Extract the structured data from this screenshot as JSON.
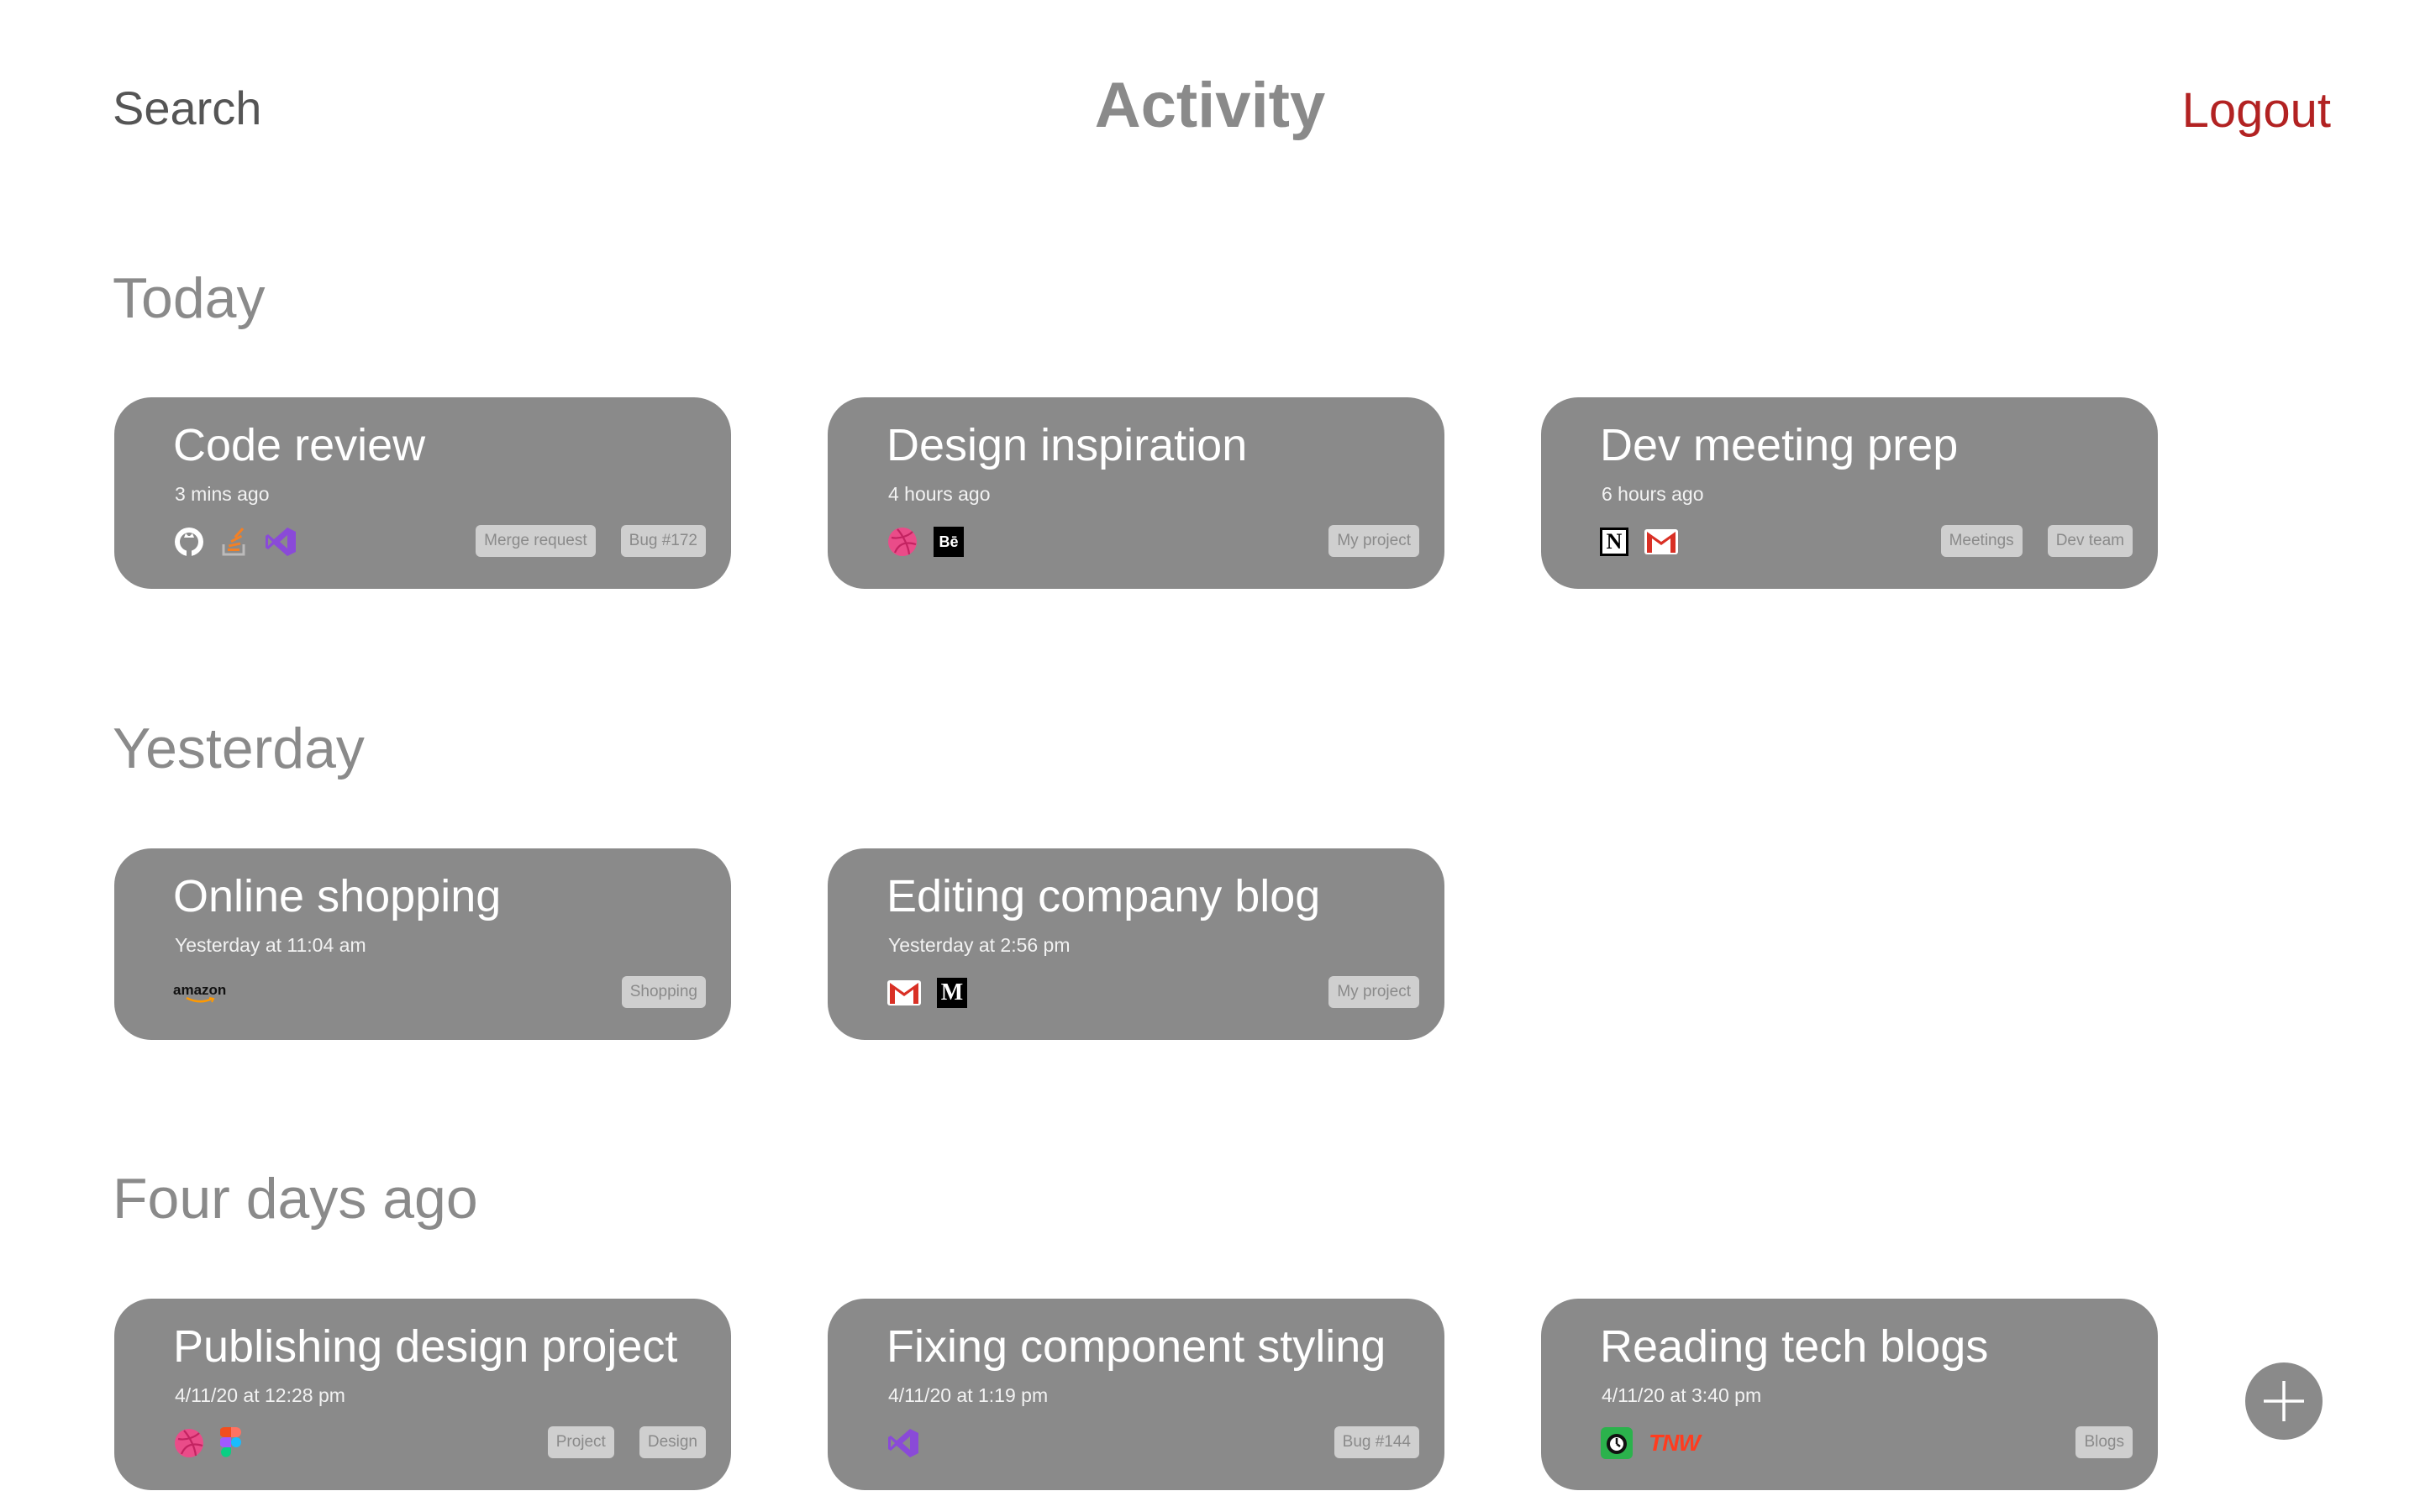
{
  "header": {
    "search_label": "Search",
    "title": "Activity",
    "logout_label": "Logout"
  },
  "sections": [
    {
      "title": "Today",
      "cards": [
        {
          "title": "Code review",
          "time": "3 mins ago",
          "icons": [
            "github-icon",
            "stack-overflow-icon",
            "visual-studio-icon"
          ],
          "tags": [
            "Merge request",
            "Bug #172"
          ]
        },
        {
          "title": "Design inspiration",
          "time": "4 hours ago",
          "icons": [
            "dribbble-icon",
            "behance-icon"
          ],
          "tags": [
            "My project"
          ]
        },
        {
          "title": "Dev meeting prep",
          "time": "6 hours ago",
          "icons": [
            "notion-icon",
            "gmail-icon"
          ],
          "tags": [
            "Meetings",
            "Dev team"
          ]
        }
      ]
    },
    {
      "title": "Yesterday",
      "cards": [
        {
          "title": "Online shopping",
          "time": "Yesterday at 11:04 am",
          "icons": [
            "amazon-icon"
          ],
          "icon_text": {
            "amazon": "amazon"
          },
          "tags": [
            "Shopping"
          ]
        },
        {
          "title": "Editing company blog",
          "time": "Yesterday at 2:56 pm",
          "icons": [
            "gmail-icon",
            "medium-icon"
          ],
          "tags": [
            "My project"
          ]
        }
      ]
    },
    {
      "title": "Four days ago",
      "cards": [
        {
          "title": "Publishing design project",
          "time": "4/11/20 at 12:28 pm",
          "icons": [
            "dribbble-icon",
            "figma-icon"
          ],
          "tags": [
            "Project",
            "Design"
          ]
        },
        {
          "title": "Fixing component styling",
          "time": "4/11/20 at 1:19 pm",
          "icons": [
            "visual-studio-icon"
          ],
          "tags": [
            "Bug #144"
          ]
        },
        {
          "title": "Reading tech blogs",
          "time": "4/11/20 at 3:40 pm",
          "icons": [
            "feedly-icon",
            "tnw-icon"
          ],
          "icon_text": {
            "tnw": "TNW"
          },
          "tags": [
            "Blogs"
          ]
        }
      ]
    }
  ],
  "icon_glyphs": {
    "behance": "Bē",
    "notion": "N",
    "medium": "M"
  },
  "colors": {
    "card": "#8a8a8a",
    "logout": "#b22222",
    "heading": "#8a8a8a",
    "tag_bg": "#cfcfcf"
  }
}
